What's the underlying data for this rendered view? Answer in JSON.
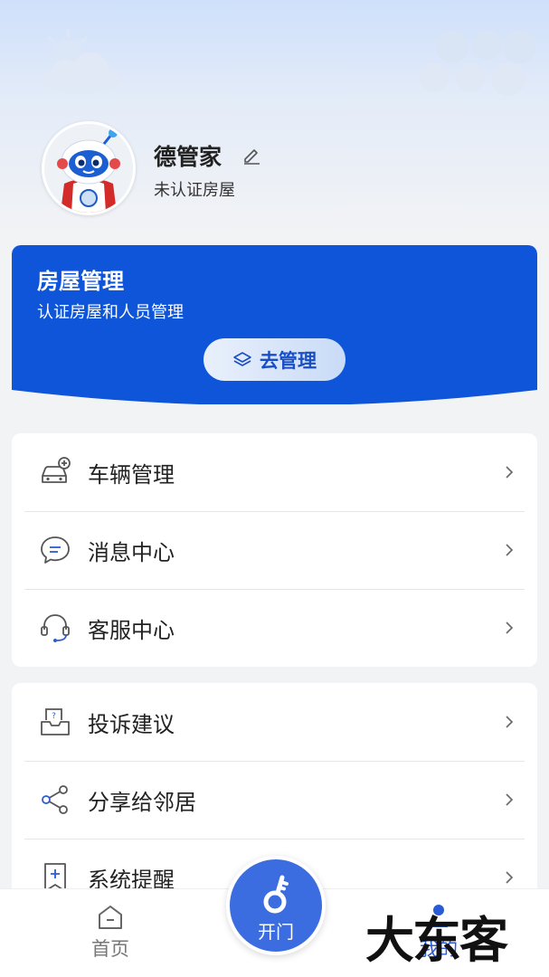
{
  "profile": {
    "username": "德管家",
    "cert_status": "未认证房屋"
  },
  "house_card": {
    "title": "房屋管理",
    "subtitle": "认证房屋和人员管理",
    "button_label": "去管理",
    "color": "#0e55d9"
  },
  "menu_group_1": [
    {
      "label": "车辆管理",
      "icon": "car-icon"
    },
    {
      "label": "消息中心",
      "icon": "message-icon"
    },
    {
      "label": "客服中心",
      "icon": "headset-icon"
    }
  ],
  "menu_group_2": [
    {
      "label": "投诉建议",
      "icon": "complaint-icon"
    },
    {
      "label": "分享给邻居",
      "icon": "share-icon"
    },
    {
      "label": "系统提醒",
      "icon": "reminder-icon"
    }
  ],
  "tabbar": {
    "home_label": "首页",
    "open_door_label": "开门",
    "mine_label": "我的",
    "active_color": "#2a5bd7"
  },
  "watermark": "大东客"
}
